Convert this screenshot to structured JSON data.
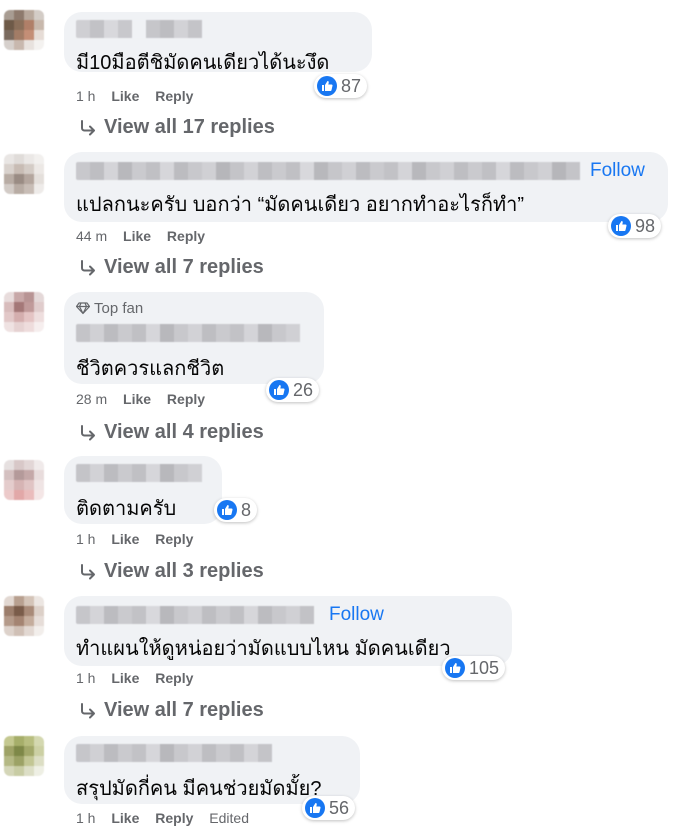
{
  "comments": [
    {
      "text": "มี10มือตีชิมัดคนเดียวได้นะงึด",
      "follow": "",
      "top_fan": "",
      "reactions": "87",
      "time": "1 h",
      "like": "Like",
      "reply": "Reply",
      "edited": "",
      "view_replies": "View all 17 replies"
    },
    {
      "text": "แปลกนะครับ บอกว่า “มัดคนเดียว อยากทำอะไรก็ทำ”",
      "follow": "Follow",
      "top_fan": "",
      "reactions": "98",
      "time": "44 m",
      "like": "Like",
      "reply": "Reply",
      "edited": "",
      "view_replies": "View all 7 replies"
    },
    {
      "text": "ชีวิตควรแลกชีวิต",
      "follow": "",
      "top_fan": "Top fan",
      "reactions": "26",
      "time": "28 m",
      "like": "Like",
      "reply": "Reply",
      "edited": "",
      "view_replies": "View all 4 replies"
    },
    {
      "text": "ติดตามครับ",
      "follow": "",
      "top_fan": "",
      "reactions": "8",
      "time": "1 h",
      "like": "Like",
      "reply": "Reply",
      "edited": "",
      "view_replies": "View all 3 replies"
    },
    {
      "text": "ทำแผนให้ดูหน่อยว่ามัดแบบไหน มัดคนเดียว",
      "follow": "Follow",
      "top_fan": "",
      "reactions": "105",
      "time": "1 h",
      "like": "Like",
      "reply": "Reply",
      "edited": "",
      "view_replies": "View all 7 replies"
    },
    {
      "text": "สรุปมัดกี่คน มีคนช่วยมัดมั้ย?",
      "follow": "",
      "top_fan": "",
      "reactions": "56",
      "time": "1 h",
      "like": "Like",
      "reply": "Reply",
      "edited": "Edited",
      "view_replies": ""
    }
  ],
  "colors": {
    "bubble": "#f0f2f5",
    "meta_text": "#65676b",
    "link_blue": "#1877f2",
    "like_blue": "#1877f2"
  },
  "icons": {
    "reaction": "thumbs-up-icon",
    "reply_arrow": "reply-arrow-icon",
    "top_fan": "diamond-icon"
  }
}
